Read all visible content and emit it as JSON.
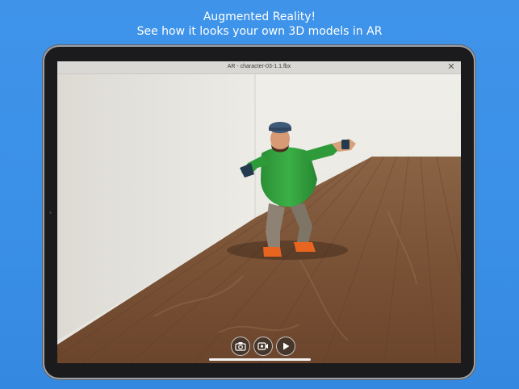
{
  "marketing": {
    "headline_line1": "Augmented Reality!",
    "headline_line2": "See how it looks your own 3D models in AR"
  },
  "window": {
    "title": "AR - character-03-1.1.fbx",
    "close_label": "✕"
  },
  "toolbar": {
    "items": [
      {
        "name": "camera-icon",
        "label": "Take photo"
      },
      {
        "name": "record-video-icon",
        "label": "Record video"
      },
      {
        "name": "play-icon",
        "label": "Play animation"
      }
    ]
  },
  "colors": {
    "background": "#3a8fe6",
    "floor": "#7a5236",
    "wall": "#e9e7e1",
    "shirt": "#2e9a3a"
  }
}
